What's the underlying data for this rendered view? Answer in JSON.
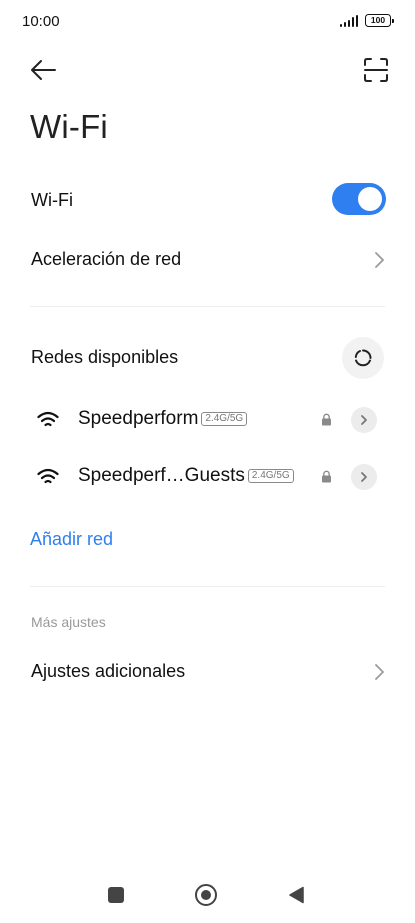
{
  "status_bar": {
    "time": "10:00",
    "battery": "100",
    "icons": [
      "signal-icon",
      "battery-icon"
    ]
  },
  "header": {
    "back_icon": "arrow-left-icon",
    "scan_icon": "qr-scan-icon",
    "title": "Wi-Fi"
  },
  "wifi_toggle": {
    "label": "Wi-Fi",
    "enabled": true,
    "accent": "#2f7ff0"
  },
  "network_acceleration": {
    "label": "Aceleración de red"
  },
  "available_networks": {
    "title": "Redes disponibles",
    "refresh_icon": "refresh-icon",
    "networks": [
      {
        "ssid": "Speedperform",
        "band": "2.4G/5G",
        "secured": true
      },
      {
        "ssid": "Speedperf…Guests",
        "band": "2.4G/5G",
        "secured": true
      }
    ]
  },
  "add_network": {
    "label": "Añadir red",
    "color": "#2f7ff0"
  },
  "more_settings": {
    "section_label": "Más ajustes",
    "additional_settings": "Ajustes adicionales"
  },
  "nav_bar": {
    "icons": [
      "recent-apps-icon",
      "home-icon",
      "back-icon"
    ]
  }
}
